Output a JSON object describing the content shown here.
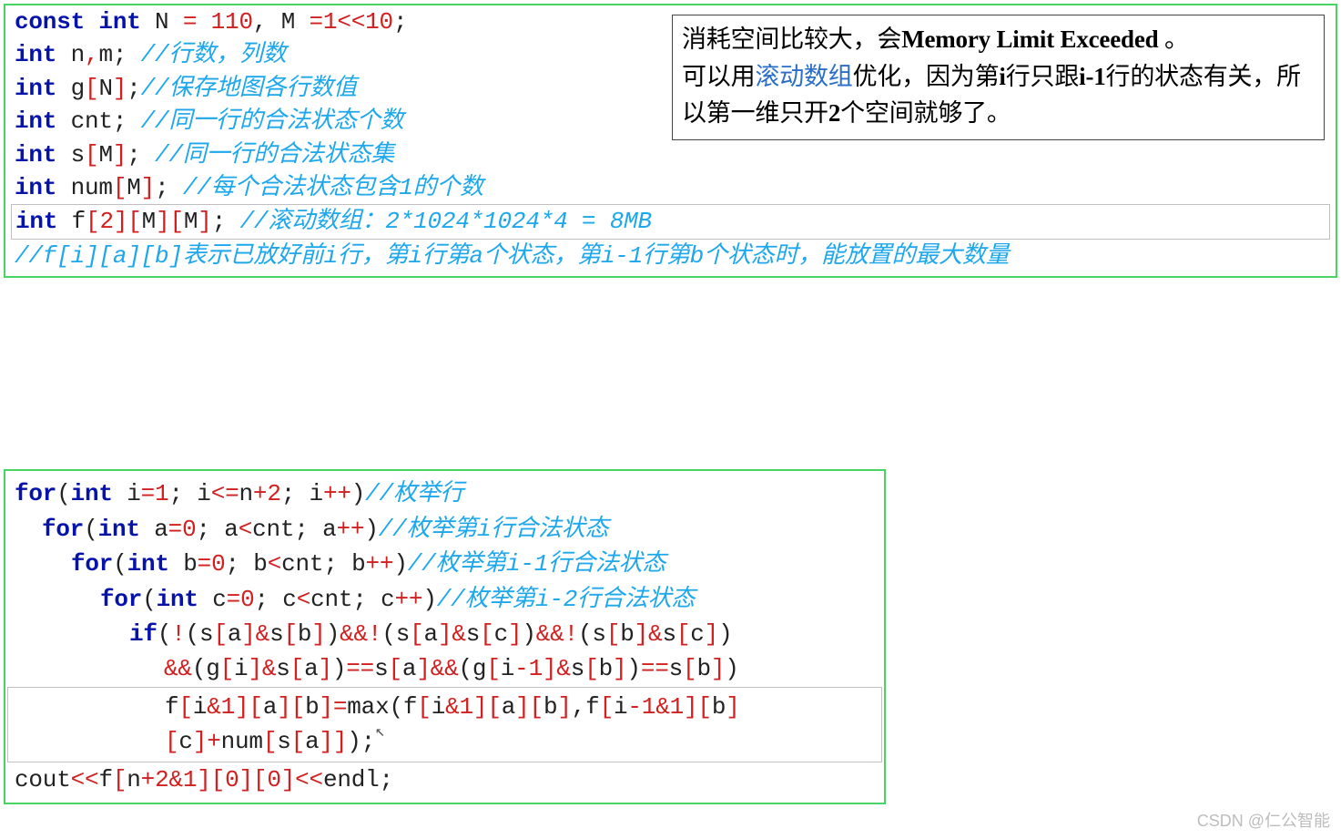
{
  "top": {
    "l1": {
      "a": "const int ",
      "b": "N ",
      "eq": "= ",
      "n110": "110",
      "comma": ", ",
      "b2": "M ",
      "eq2": "=",
      "one": "1",
      "lt": "<<",
      "ten": "10",
      "semi": ";"
    },
    "l2": {
      "a": "int ",
      "b": "n",
      "comma": ",",
      "c": "m",
      "semi": ";",
      "d": " //行数，列数"
    },
    "l3": {
      "a": "int ",
      "b": "g",
      "lb": "[",
      "n": "N",
      "rb": "]",
      "semi": ";",
      "d": "//保存地图各行数值"
    },
    "l4": {
      "a": "int ",
      "b": "cnt",
      "semi": ";",
      "d": " //同一行的合法状态个数"
    },
    "l5": {
      "a": "int ",
      "b": "s",
      "lb": "[",
      "m": "M",
      "rb": "]",
      "semi": ";",
      "d": " //同一行的合法状态集"
    },
    "l6": {
      "a": "int ",
      "b": "num",
      "lb": "[",
      "m": "M",
      "rb": "]",
      "semi": ";",
      "d": " //每个合法状态包含1的个数"
    },
    "l7": {
      "a": "int ",
      "b": "f",
      "lb1": "[",
      "n1": "2",
      "rb1": "][",
      "n2": "M",
      "rb2": "][",
      "n3": "M",
      "rb3": "]",
      "semi": ";",
      "d": " //滚动数组：2*1024*1024*4 = 8MB"
    },
    "l8": "//f[i][a][b]表示已放好前i行，第i行第a个状态，第i-1行第b个状态时，能放置的最大数量"
  },
  "callout": {
    "a": "消耗空间比较大，会",
    "b": "Memory Limit Exceeded",
    "c": " 。",
    "d": "可以用",
    "e": "滚动数组",
    "f": "优化，因为第",
    "g": "i",
    "h": "行只跟",
    "i": "i-1",
    "j": "行的状态有关，所以第一维只开",
    "k": "2",
    "l": "个空间就够了。"
  },
  "bot": {
    "l1": {
      "for": "for",
      "op": "(",
      "int": "int ",
      "i": "i",
      "eq": "=",
      "n1": "1",
      "semi": "; ",
      "cond": "i<=n+",
      "n2": "2",
      "semi2": "; ",
      "inc": "i++",
      "cp": ")",
      "cmt": "//枚举行"
    },
    "l2": {
      "for": "for",
      "op": "(",
      "int": "int ",
      "a": "a",
      "eq": "=",
      "n0": "0",
      "semi": "; ",
      "cond": "a<cnt",
      "semi2": "; ",
      "inc": "a++",
      "cp": ")",
      "cmt": "//枚举第i行合法状态"
    },
    "l3": {
      "for": "for",
      "op": "(",
      "int": "int ",
      "b": "b",
      "eq": "=",
      "n0": "0",
      "semi": "; ",
      "cond": "b<cnt",
      "semi2": "; ",
      "inc": "b++",
      "cp": ")",
      "cmt": "//枚举第i-1行合法状态"
    },
    "l4": {
      "for": "for",
      "op": "(",
      "int": "int ",
      "c": "c",
      "eq": "=",
      "n0": "0",
      "semi": "; ",
      "cond": "c<cnt",
      "semi2": "; ",
      "inc": "c++",
      "cp": ")",
      "cmt": "//枚举第i-2行合法状态"
    },
    "l5": {
      "if": "if",
      "rest": "(!(s[a]&s[b])&&!(s[a]&s[c])&&!(s[b]&s[c])"
    },
    "l6": "&&(g[i]&s[a])==s[a]&&(g[i-1]&s[b])==s[b])",
    "l7": {
      "a": "f[i&",
      "one": "1",
      "b": "][a][b]=max(f[i&",
      "one2": "1",
      "c": "][a][b],f[i-",
      "one3": "1",
      "amp": "&",
      "one4": "1",
      "d": "][b][c]+num[s[a]]);"
    },
    "l8": {
      "a": "cout<<f[n+",
      "two": "2",
      "amp": "&",
      "one": "1",
      "b": "][",
      "z1": "0",
      "c": "][",
      "z2": "0",
      "d": "]<<endl;"
    }
  },
  "watermark": "CSDN @仁公智能"
}
